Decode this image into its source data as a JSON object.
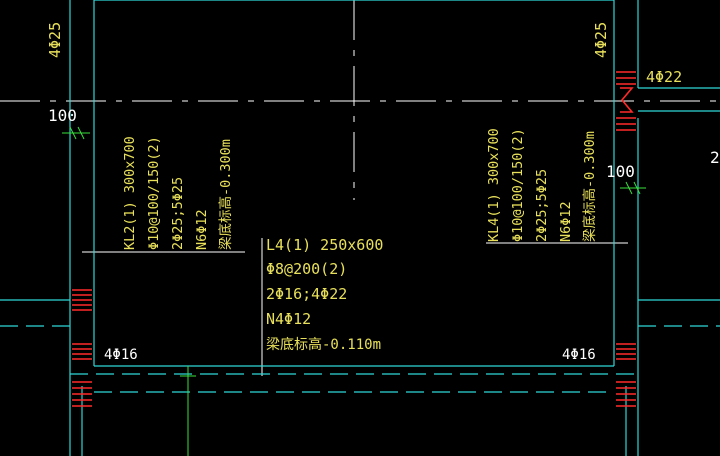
{
  "colors": {
    "background": "#000000",
    "wall": "#2fd6d6",
    "axis": "#ffffff",
    "annotation": "#e8e05a",
    "rebar": "#ff2a2a",
    "dimension": "#3ae03a",
    "leader": "#ffffff"
  },
  "labels": {
    "top_left_rebar": "4Φ25",
    "top_right_rebar": "4Φ25",
    "right_rebar": "4Φ22",
    "left_dim": "100",
    "right_dim": "100",
    "edge_fragment": "2",
    "bottom_left_rebar": "4Φ16",
    "bottom_right_rebar": "4Φ16"
  },
  "kl2": {
    "line1": "KL2(1) 300x700",
    "line2": "Φ10@100/150(2)",
    "line3": "2Φ25;5Φ25",
    "line4": "N6Φ12",
    "line5": "梁底标高-0.300m"
  },
  "kl4": {
    "line1": "KL4(1) 300x700",
    "line2": "Φ10@100/150(2)",
    "line3": "2Φ25;5Φ25",
    "line4": "N6Φ12",
    "line5": "梁底标高-0.300m"
  },
  "l4": {
    "line1": "L4(1) 250x600",
    "line2": "Φ8@200(2)",
    "line3": "2Φ16;4Φ22",
    "line4": "N4Φ12",
    "line5": "梁底标高-0.110m"
  }
}
